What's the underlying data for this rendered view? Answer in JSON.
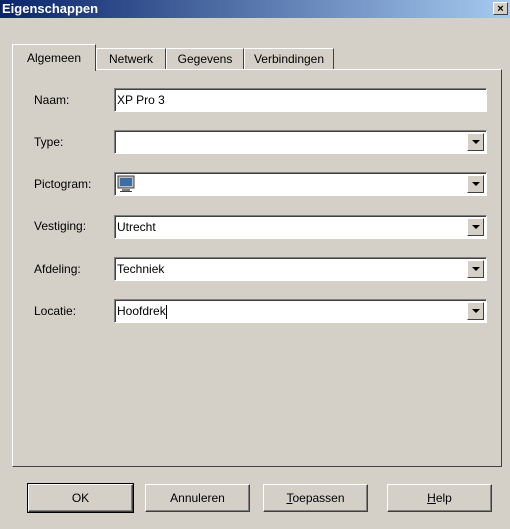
{
  "window": {
    "title": "Eigenschappen",
    "close_label": "×"
  },
  "tabs": [
    {
      "label": "Algemeen",
      "active": true
    },
    {
      "label": "Netwerk",
      "active": false
    },
    {
      "label": "Gegevens",
      "active": false
    },
    {
      "label": "Verbindingen",
      "active": false
    }
  ],
  "form": {
    "naam": {
      "label": "Naam:",
      "value": "XP Pro 3"
    },
    "type": {
      "label": "Type:",
      "value": ""
    },
    "pictogram": {
      "label": "Pictogram:",
      "icon": "computer-monitor-icon"
    },
    "vestiging": {
      "label": "Vestiging:",
      "value": "Utrecht"
    },
    "afdeling": {
      "label": "Afdeling:",
      "value": "Techniek"
    },
    "locatie": {
      "label": "Locatie:",
      "value": "Hoofdrek"
    }
  },
  "buttons": {
    "ok": "OK",
    "annuleren": "Annuleren",
    "toepassen_first": "T",
    "toepassen_rest": "oepassen",
    "help_first": "H",
    "help_rest": "elp"
  }
}
